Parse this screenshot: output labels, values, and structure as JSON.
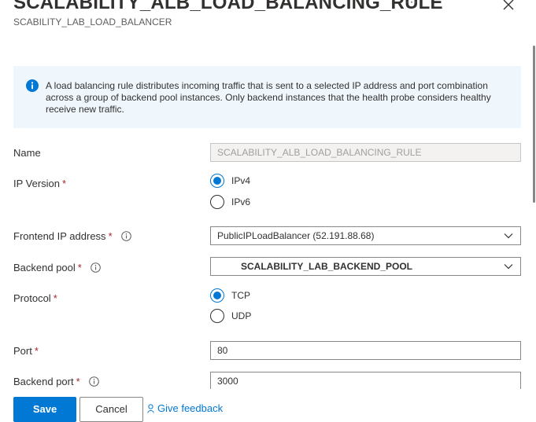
{
  "header": {
    "title": "SCALABILITY_ALB_LOAD_BALANCING_RULE",
    "subtitle": "SCABILITY_LAB_LOAD_BALANCER",
    "more_glyph": "···"
  },
  "info": {
    "icon": "info-icon",
    "text": "A load balancing rule distributes incoming traffic that is sent to a selected IP address and port combination across a group of backend pool instances. Only backend instances that the health probe considers healthy receive new traffic."
  },
  "form": {
    "name": {
      "label": "Name",
      "value": "SCALABILITY_ALB_LOAD_BALANCING_RULE"
    },
    "ip_version": {
      "label": "IP Version",
      "required": "*",
      "options": [
        {
          "label": "IPv4",
          "checked": true
        },
        {
          "label": "IPv6",
          "checked": false
        }
      ]
    },
    "frontend_ip": {
      "label": "Frontend IP address",
      "required": "*",
      "value": "PublicIPLoadBalancer (52.191.88.68)"
    },
    "backend_pool": {
      "label": "Backend pool",
      "required": "*",
      "value": "SCALABILITY_LAB_BACKEND_POOL"
    },
    "protocol": {
      "label": "Protocol",
      "required": "*",
      "options": [
        {
          "label": "TCP",
          "checked": true
        },
        {
          "label": "UDP",
          "checked": false
        }
      ]
    },
    "port": {
      "label": "Port",
      "required": "*",
      "value": "80"
    },
    "backend_port": {
      "label": "Backend port",
      "required": "*",
      "value": "3000"
    }
  },
  "footer": {
    "save_label": "Save",
    "cancel_label": "Cancel",
    "feedback_label": "Give feedback"
  },
  "colors": {
    "accent": "#0078d4",
    "required": "#a4262c",
    "info_bg": "#eff6fc"
  }
}
